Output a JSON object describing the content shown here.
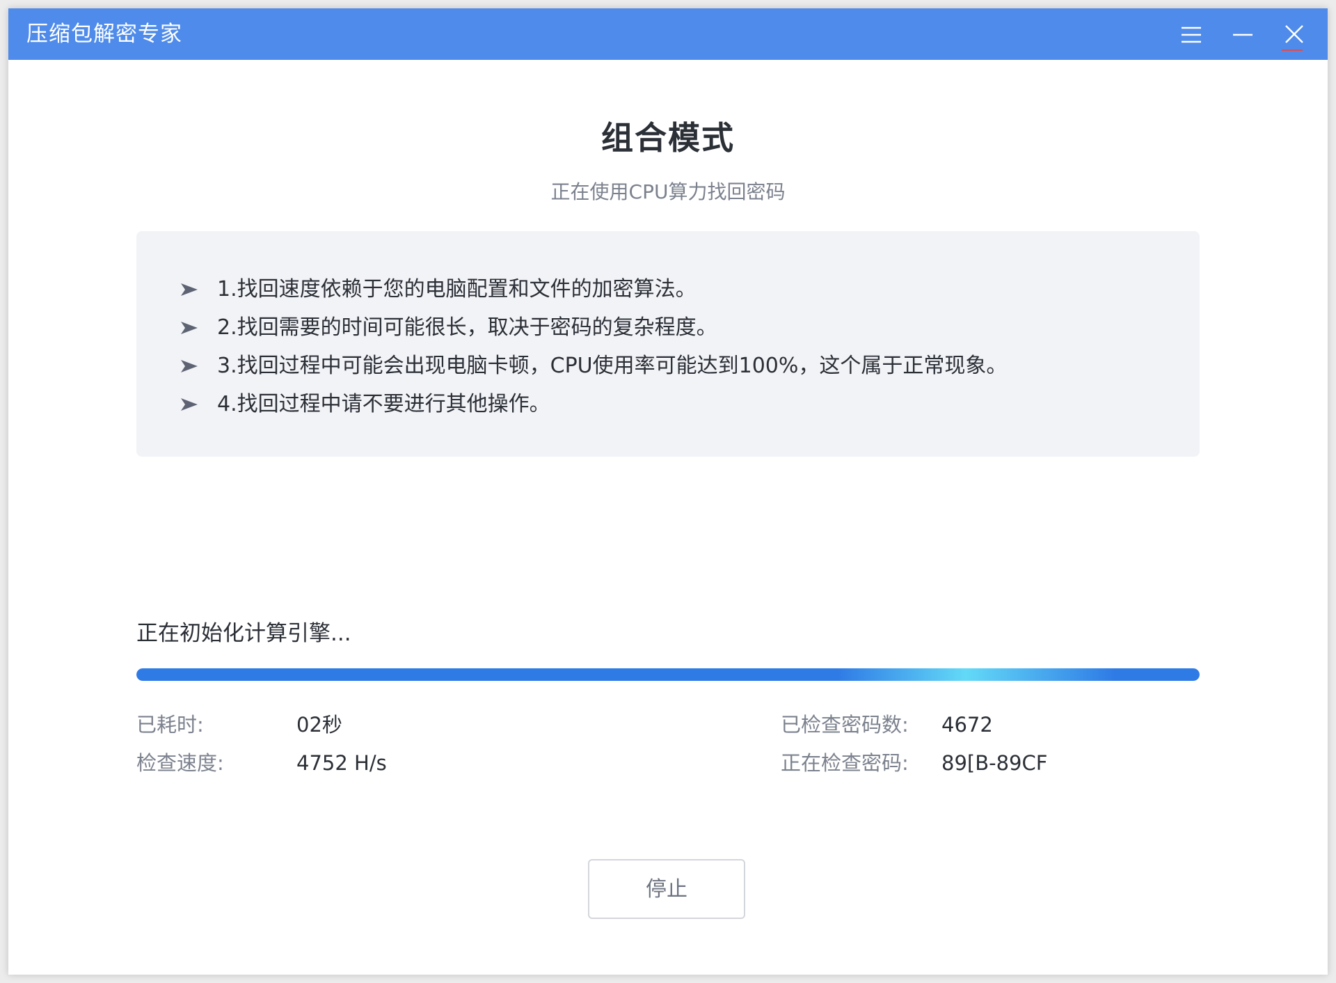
{
  "window": {
    "title": "压缩包解密专家"
  },
  "header": {
    "mode_title": "组合模式",
    "subtitle": "正在使用CPU算力找回密码"
  },
  "tips": [
    "1.找回速度依赖于您的电脑配置和文件的加密算法。",
    "2.找回需要的时间可能很长，取决于密码的复杂程度。",
    "3.找回过程中可能会出现电脑卡顿，CPU使用率可能达到100%，这个属于正常现象。",
    "4.找回过程中请不要进行其他操作。"
  ],
  "progress": {
    "status": "正在初始化计算引擎...",
    "fill_fraction": 1.0
  },
  "stats": {
    "elapsed_label": "已耗时:",
    "elapsed_value": "02秒",
    "speed_label": "检查速度:",
    "speed_value": "4752 H/s",
    "checked_label": "已检查密码数:",
    "checked_value": "4672",
    "current_label": "正在检查密码:",
    "current_value": "89[B-89CF"
  },
  "buttons": {
    "stop": "停止"
  },
  "icons": {
    "menu": "menu-icon",
    "minimize": "minimize-icon",
    "close": "close-icon",
    "bullet": "arrow-bullet-icon"
  },
  "colors": {
    "titlebar": "#4e8bea",
    "progress": "#2f7be6",
    "progress_highlight": "#63d9f7"
  }
}
